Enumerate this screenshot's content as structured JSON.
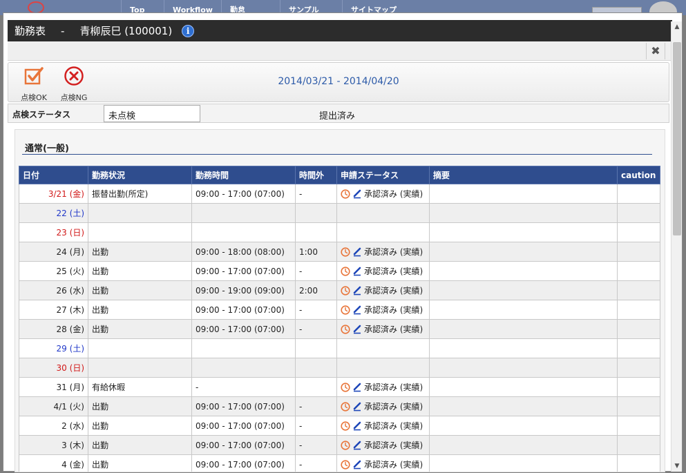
{
  "bg_nav": {
    "items": [
      "Top",
      "Workflow",
      "勤怠",
      "サンプル",
      "サイトマップ"
    ]
  },
  "window": {
    "title": "勤務表",
    "separator": "-",
    "employee": "青柳辰巳 (100001)",
    "info_icon": "info-icon",
    "close_icon": "close-icon"
  },
  "toolbar": {
    "ok_label": "点検OK",
    "ng_label": "点検NG",
    "period": "2014/03/21 - 2014/04/20"
  },
  "status": {
    "label": "点検ステータス",
    "value": "未点検",
    "submission": "提出済み"
  },
  "section": {
    "title": "通常(一般)"
  },
  "table": {
    "headers": [
      "日付",
      "勤務状況",
      "勤務時間",
      "時間外",
      "申請ステータス",
      "摘要",
      "caution"
    ],
    "rows": [
      {
        "date": "3/21 (金)",
        "day": "holiday",
        "status": "振替出勤(所定)",
        "hours": "09:00 - 17:00 (07:00)",
        "overtime": "-",
        "app_status": "承認済み (実績)",
        "note": "",
        "caution": ""
      },
      {
        "date": "22 (土)",
        "day": "sat",
        "status": "",
        "hours": "",
        "overtime": "",
        "app_status": "",
        "note": "",
        "caution": ""
      },
      {
        "date": "23 (日)",
        "day": "sun",
        "status": "",
        "hours": "",
        "overtime": "",
        "app_status": "",
        "note": "",
        "caution": ""
      },
      {
        "date": "24 (月)",
        "day": "weekday",
        "status": "出勤",
        "hours": "09:00 - 18:00 (08:00)",
        "overtime": "1:00",
        "app_status": "承認済み (実績)",
        "note": "",
        "caution": ""
      },
      {
        "date": "25 (火)",
        "day": "weekday",
        "status": "出勤",
        "hours": "09:00 - 17:00 (07:00)",
        "overtime": "-",
        "app_status": "承認済み (実績)",
        "note": "",
        "caution": ""
      },
      {
        "date": "26 (水)",
        "day": "weekday",
        "status": "出勤",
        "hours": "09:00 - 19:00 (09:00)",
        "overtime": "2:00",
        "app_status": "承認済み (実績)",
        "note": "",
        "caution": ""
      },
      {
        "date": "27 (木)",
        "day": "weekday",
        "status": "出勤",
        "hours": "09:00 - 17:00 (07:00)",
        "overtime": "-",
        "app_status": "承認済み (実績)",
        "note": "",
        "caution": ""
      },
      {
        "date": "28 (金)",
        "day": "weekday",
        "status": "出勤",
        "hours": "09:00 - 17:00 (07:00)",
        "overtime": "-",
        "app_status": "承認済み (実績)",
        "note": "",
        "caution": ""
      },
      {
        "date": "29 (土)",
        "day": "sat",
        "status": "",
        "hours": "",
        "overtime": "",
        "app_status": "",
        "note": "",
        "caution": ""
      },
      {
        "date": "30 (日)",
        "day": "sun",
        "status": "",
        "hours": "",
        "overtime": "",
        "app_status": "",
        "note": "",
        "caution": ""
      },
      {
        "date": "31 (月)",
        "day": "weekday",
        "status": "有給休暇",
        "hours": "-",
        "overtime": "",
        "app_status": "承認済み (実績)",
        "note": "",
        "caution": ""
      },
      {
        "date": "4/1 (火)",
        "day": "weekday",
        "status": "出勤",
        "hours": "09:00 - 17:00 (07:00)",
        "overtime": "-",
        "app_status": "承認済み (実績)",
        "note": "",
        "caution": ""
      },
      {
        "date": "2 (水)",
        "day": "weekday",
        "status": "出勤",
        "hours": "09:00 - 17:00 (07:00)",
        "overtime": "-",
        "app_status": "承認済み (実績)",
        "note": "",
        "caution": ""
      },
      {
        "date": "3 (木)",
        "day": "weekday",
        "status": "出勤",
        "hours": "09:00 - 17:00 (07:00)",
        "overtime": "-",
        "app_status": "承認済み (実績)",
        "note": "",
        "caution": ""
      },
      {
        "date": "4 (金)",
        "day": "weekday",
        "status": "出勤",
        "hours": "09:00 - 17:00 (07:00)",
        "overtime": "-",
        "app_status": "承認済み (実績)",
        "note": "",
        "caution": ""
      }
    ]
  },
  "colors": {
    "header_bg": "#2f4d8e",
    "saturday": "#2037c8",
    "sunday": "#d11919",
    "accent_orange": "#e8753a",
    "ng_red": "#d32020",
    "link_blue": "#2c5aa8"
  }
}
